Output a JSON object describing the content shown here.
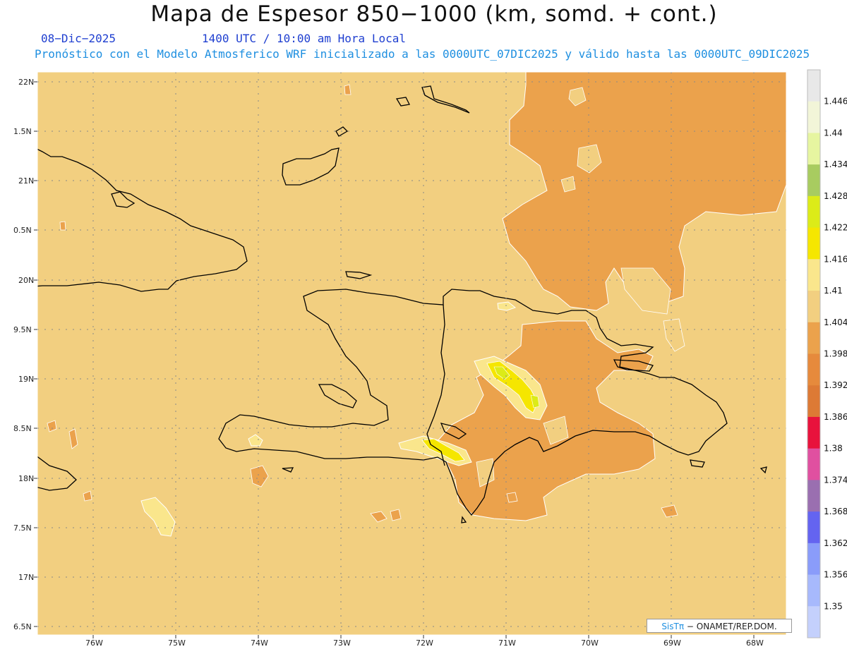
{
  "header": {
    "title": "Mapa de Espesor 850−1000 (km, somd. + cont.)",
    "date": "08−Dic−2025",
    "time": "1400 UTC / 10:00 am Hora Local",
    "info": "Pronóstico con el Modelo Atmosferico WRF inicializado a las 0000UTC_07DIC2025 y válido hasta las  0000UTC_09DIC2025"
  },
  "axes": {
    "lat_labels": [
      "22N",
      "1.5N",
      "21N",
      "0.5N",
      "20N",
      "9.5N",
      "19N",
      "8.5N",
      "18N",
      "7.5N",
      "17N",
      "6.5N"
    ],
    "lon_labels": [
      "76W",
      "75W",
      "74W",
      "73W",
      "72W",
      "71W",
      "70W",
      "69W",
      "68W"
    ]
  },
  "colorbar": {
    "labels": [
      "1.446",
      "1.44",
      "1.434",
      "1.428",
      "1.422",
      "1.416",
      "1.41",
      "1.404",
      "1.398",
      "1.392",
      "1.386",
      "1.38",
      "1.374",
      "1.368",
      "1.362",
      "1.356",
      "1.35"
    ],
    "colors": [
      "#e8e8e8",
      "#f2f5d8",
      "#e6f5a0",
      "#a8cc60",
      "#dceb18",
      "#f5e600",
      "#fae68c",
      "#f2cf80",
      "#eba24c",
      "#e68a3c",
      "#dd7a35",
      "#e8123c",
      "#e050a0",
      "#9a6fb0",
      "#6464f0",
      "#8a9cfa",
      "#a7b9fc",
      "#c4d0fc"
    ]
  },
  "colors": {
    "background_field": "#f2cf80",
    "field_1398": "#eba24c",
    "field_1410": "#fae68c",
    "field_1416": "#f5e600",
    "field_1422": "#dceb18"
  },
  "credit": {
    "brand": "SisTπ",
    "text": "− ONAMET/REP.DOM."
  }
}
